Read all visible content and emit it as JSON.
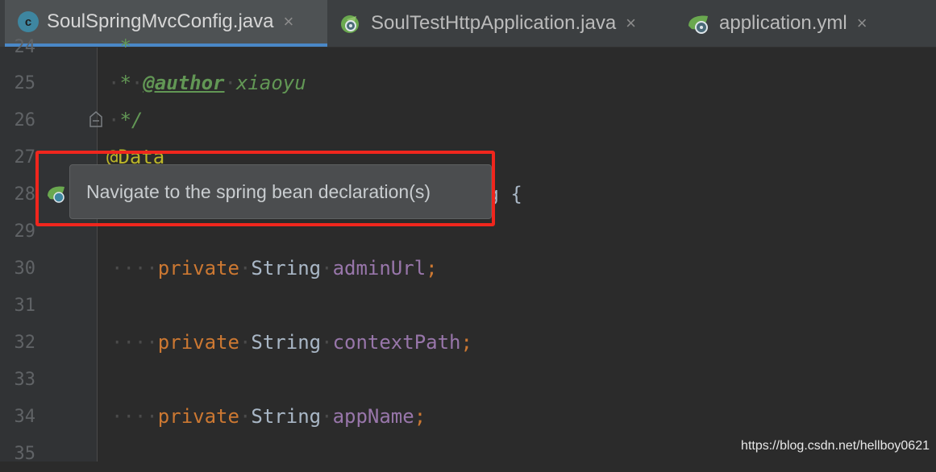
{
  "tabs": [
    {
      "name": "SoulSpringMvcConfig.java",
      "icon": "class-icon",
      "active": true
    },
    {
      "name": "SoulTestHttpApplication.java",
      "icon": "spring-boot-run-icon",
      "active": false
    },
    {
      "name": "application.yml",
      "icon": "spring-leaf-icon",
      "active": false
    }
  ],
  "close_glyph": "×",
  "class_icon_letter": "c",
  "lines": [
    {
      "num": "24",
      "text": " *"
    },
    {
      "num": "25",
      "text": " * @author xiaoyu"
    },
    {
      "num": "26",
      "text": " */"
    },
    {
      "num": "27",
      "text": "@Data"
    },
    {
      "num": "28",
      "text": "ig {"
    },
    {
      "num": "29",
      "text": ""
    },
    {
      "num": "30",
      "text": "    private String adminUrl;"
    },
    {
      "num": "31",
      "text": ""
    },
    {
      "num": "32",
      "text": "    private String contextPath;"
    },
    {
      "num": "33",
      "text": ""
    },
    {
      "num": "34",
      "text": "    private String appName;"
    },
    {
      "num": "35",
      "text": ""
    }
  ],
  "code": {
    "comment_star": "*",
    "author_tag": "@author",
    "author_name": "xiaoyu",
    "comment_end": "*/",
    "annotation": "@Data",
    "class_tail": "ig {",
    "kw_private": "private",
    "type_string": "String",
    "field1": "adminUrl",
    "field2": "contextPath",
    "field3": "appName",
    "semicolon": ";",
    "indent_dots": "····"
  },
  "tooltip": {
    "text": "Navigate to the spring bean declaration(s)"
  },
  "watermark": "https://blog.csdn.net/hellboy0621",
  "colors": {
    "highlight_border": "#f0261d",
    "active_tab_underline": "#4a88c7"
  }
}
